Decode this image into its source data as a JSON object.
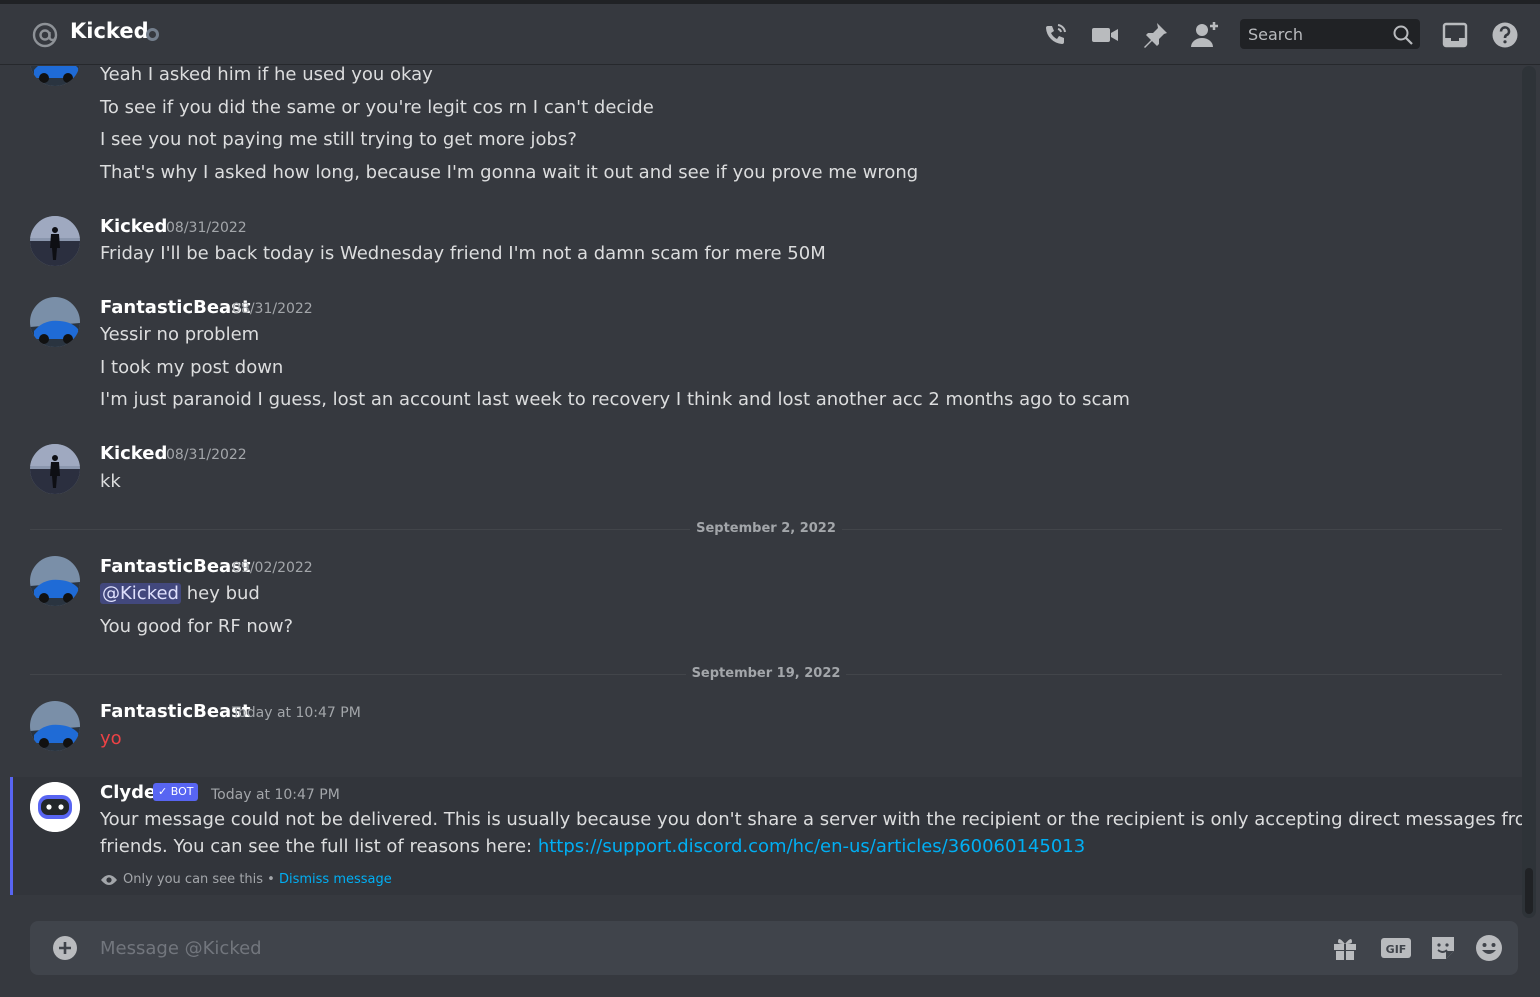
{
  "header": {
    "title": "Kicked",
    "search_placeholder": "Search",
    "icons": [
      "at-icon",
      "start-voice-call-icon",
      "start-video-call-icon",
      "pinned-messages-icon",
      "add-friends-to-dm-icon",
      "search-icon",
      "inbox-icon",
      "help-icon"
    ]
  },
  "messages": {
    "partial_group": {
      "lines": [
        "Yeah I asked him if he used you okay",
        "To see if you did the same or you're legit cos rn I can't decide",
        "I see you not paying me still trying to get more jobs?",
        "That's why I asked how long, because I'm gonna wait it out and see if you prove me wrong"
      ]
    },
    "group1": {
      "author": "Kicked",
      "timestamp": "08/31/2022",
      "lines": [
        "Friday I'll be back today is Wednesday friend I'm not a damn scam for mere 50M"
      ]
    },
    "group2": {
      "author": "FantasticBeast",
      "timestamp": "08/31/2022",
      "lines": [
        "Yessir no problem",
        "I took my post down",
        "I'm just paranoid I guess, lost an account last week to recovery I think and lost another acc 2 months ago to scam"
      ]
    },
    "group3": {
      "author": "Kicked",
      "timestamp": "08/31/2022",
      "lines": [
        "kk"
      ]
    },
    "divider1": "September 2, 2022",
    "group4": {
      "author": "FantasticBeast",
      "timestamp": "09/02/2022",
      "mention": "@Kicked",
      "line1_rest": " hey bud",
      "line2": "You good for RF now?"
    },
    "divider2": "September 19, 2022",
    "group5": {
      "author": "FantasticBeast",
      "timestamp": "Today at 10:47 PM",
      "line": "yo",
      "failed_color": "#ed4245"
    },
    "clyde": {
      "author": "Clyde",
      "bot_tag": "BOT",
      "timestamp": "Today at 10:47 PM",
      "text_line1": "Your message could not be delivered. This is usually because you don't share a server with the recipient or the recipient is only accepting direct messages from",
      "text_line2": "friends. You can see the full list of reasons here: ",
      "link": "https://support.discord.com/hc/en-us/articles/360060145013",
      "only_you": "Only you can see this",
      "separator": " • ",
      "dismiss": "Dismiss message"
    }
  },
  "composer": {
    "placeholder": "Message @Kicked",
    "tools": [
      "upload-plus-icon",
      "gift-icon",
      "gif-icon",
      "sticker-icon",
      "emoji-icon"
    ],
    "gif_label": "GIF"
  },
  "colors": {
    "background": "#36393f",
    "accent": "#5865f2",
    "link": "#00aff4",
    "error": "#ed4245"
  }
}
